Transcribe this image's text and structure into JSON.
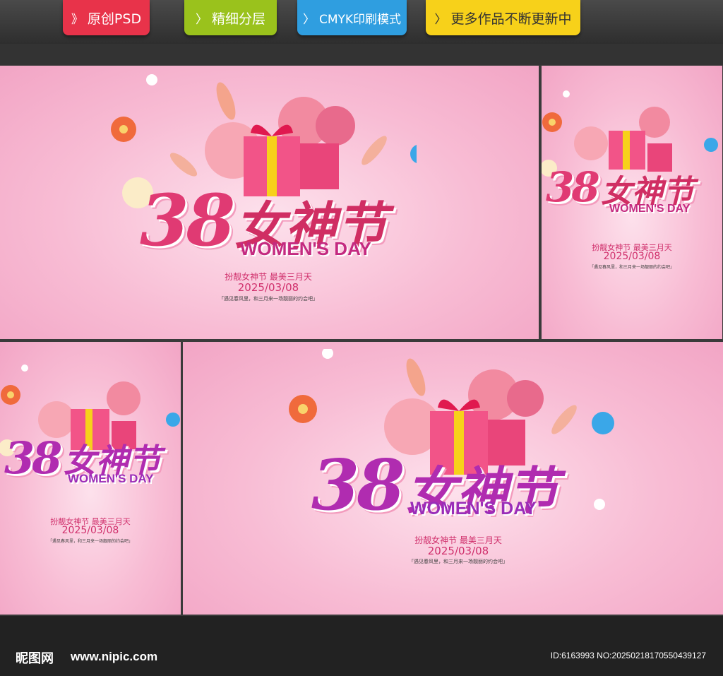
{
  "header": {
    "tags": [
      {
        "chevron": "》",
        "label": "原创PSD"
      },
      {
        "chevron": "〉",
        "label": "精细分层"
      },
      {
        "chevron": "〉",
        "label": "CMYK印刷模式"
      },
      {
        "chevron": "〉",
        "label": "更多作品不断更新中"
      }
    ]
  },
  "poster": {
    "number": "38",
    "title": "女神节",
    "subtitle_en": "WOMEN'S DAY",
    "slogan": "扮靓女神节 最美三月天",
    "date": "2025/03/08",
    "tagline": "「遇见春风里，和三月来一场靓丽的约会吧」"
  },
  "footer": {
    "logo": "昵图网",
    "site": "www.nipic.com",
    "id_text": "ID:6163993 NO:20250218170550439127"
  },
  "colors": {
    "pink": "#e03a73",
    "purple": "#b02cb0",
    "tag_red": "#e8334a",
    "tag_green": "#9ac21c",
    "tag_blue": "#2f9ee0",
    "tag_yellow": "#f7d11a"
  },
  "icons": [
    "gift-icon",
    "flower-icon",
    "leaf-icon",
    "shopping-bag-icon",
    "daisy-icon"
  ]
}
